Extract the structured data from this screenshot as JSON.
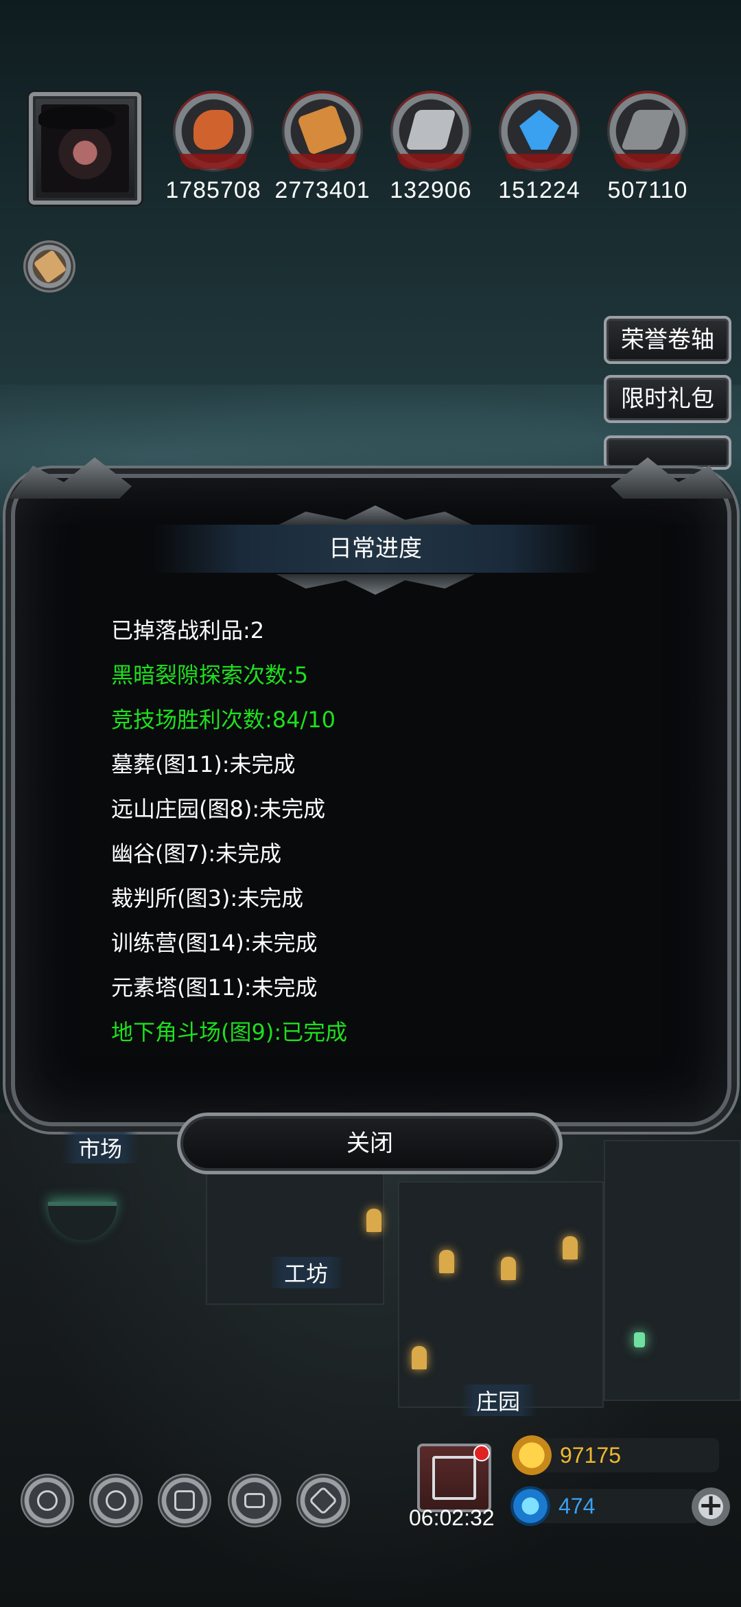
{
  "resources": [
    {
      "icon": "meat-icon",
      "value": "1785708",
      "color": "#d0622e"
    },
    {
      "icon": "wood-planks-icon",
      "value": "2773401",
      "color": "#d58a3c"
    },
    {
      "icon": "iron-ingot-icon",
      "value": "132906",
      "color": "#b9bcc0"
    },
    {
      "icon": "crystal-icon",
      "value": "151224",
      "color": "#3aa0f0"
    },
    {
      "icon": "metal-bars-icon",
      "value": "507110",
      "color": "#8a8d90"
    }
  ],
  "side_buttons": {
    "honor_scroll": "荣誉卷轴",
    "limited_gift": "限时礼包"
  },
  "dialog": {
    "title": "日常进度",
    "lines": [
      {
        "text": "已掉落战利品:2",
        "done": false
      },
      {
        "text": "黑暗裂隙探索次数:5",
        "done": true
      },
      {
        "text": "竞技场胜利次数:84/10",
        "done": true
      },
      {
        "text": "墓葬(图11):未完成",
        "done": false
      },
      {
        "text": "远山庄园(图8):未完成",
        "done": false
      },
      {
        "text": "幽谷(图7):未完成",
        "done": false
      },
      {
        "text": "裁判所(图3):未完成",
        "done": false
      },
      {
        "text": "训练营(图14):未完成",
        "done": false
      },
      {
        "text": "元素塔(图11):未完成",
        "done": false
      },
      {
        "text": "地下角斗场(图9):已完成",
        "done": true
      }
    ],
    "close_label": "关闭"
  },
  "town_labels": {
    "market": "市场",
    "workshop": "工坊",
    "manor": "庄园"
  },
  "bottom_bar": {
    "icons": [
      "settings-gear-icon",
      "star-badge-icon",
      "castle-gate-icon",
      "mail-icon",
      "handshake-icon"
    ],
    "gift_timer": "06:02:32",
    "gold": "97175",
    "gems": "474",
    "gold_color": "#f0b830",
    "gem_color": "#3aa0f0"
  },
  "colors": {
    "completed_text": "#1ee01e",
    "normal_text": "#ffffff"
  }
}
